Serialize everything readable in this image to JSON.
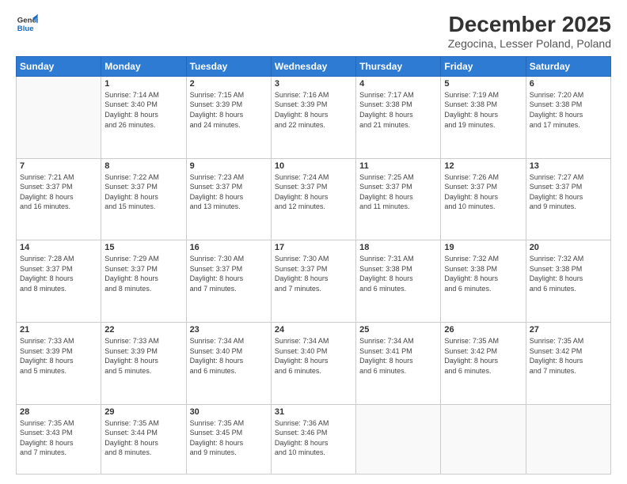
{
  "logo": {
    "line1": "General",
    "line2": "Blue"
  },
  "title": "December 2025",
  "subtitle": "Zegocina, Lesser Poland, Poland",
  "days_of_week": [
    "Sunday",
    "Monday",
    "Tuesday",
    "Wednesday",
    "Thursday",
    "Friday",
    "Saturday"
  ],
  "weeks": [
    [
      {
        "day": "",
        "info": ""
      },
      {
        "day": "1",
        "info": "Sunrise: 7:14 AM\nSunset: 3:40 PM\nDaylight: 8 hours\nand 26 minutes."
      },
      {
        "day": "2",
        "info": "Sunrise: 7:15 AM\nSunset: 3:39 PM\nDaylight: 8 hours\nand 24 minutes."
      },
      {
        "day": "3",
        "info": "Sunrise: 7:16 AM\nSunset: 3:39 PM\nDaylight: 8 hours\nand 22 minutes."
      },
      {
        "day": "4",
        "info": "Sunrise: 7:17 AM\nSunset: 3:38 PM\nDaylight: 8 hours\nand 21 minutes."
      },
      {
        "day": "5",
        "info": "Sunrise: 7:19 AM\nSunset: 3:38 PM\nDaylight: 8 hours\nand 19 minutes."
      },
      {
        "day": "6",
        "info": "Sunrise: 7:20 AM\nSunset: 3:38 PM\nDaylight: 8 hours\nand 17 minutes."
      }
    ],
    [
      {
        "day": "7",
        "info": "Sunrise: 7:21 AM\nSunset: 3:37 PM\nDaylight: 8 hours\nand 16 minutes."
      },
      {
        "day": "8",
        "info": "Sunrise: 7:22 AM\nSunset: 3:37 PM\nDaylight: 8 hours\nand 15 minutes."
      },
      {
        "day": "9",
        "info": "Sunrise: 7:23 AM\nSunset: 3:37 PM\nDaylight: 8 hours\nand 13 minutes."
      },
      {
        "day": "10",
        "info": "Sunrise: 7:24 AM\nSunset: 3:37 PM\nDaylight: 8 hours\nand 12 minutes."
      },
      {
        "day": "11",
        "info": "Sunrise: 7:25 AM\nSunset: 3:37 PM\nDaylight: 8 hours\nand 11 minutes."
      },
      {
        "day": "12",
        "info": "Sunrise: 7:26 AM\nSunset: 3:37 PM\nDaylight: 8 hours\nand 10 minutes."
      },
      {
        "day": "13",
        "info": "Sunrise: 7:27 AM\nSunset: 3:37 PM\nDaylight: 8 hours\nand 9 minutes."
      }
    ],
    [
      {
        "day": "14",
        "info": "Sunrise: 7:28 AM\nSunset: 3:37 PM\nDaylight: 8 hours\nand 8 minutes."
      },
      {
        "day": "15",
        "info": "Sunrise: 7:29 AM\nSunset: 3:37 PM\nDaylight: 8 hours\nand 8 minutes."
      },
      {
        "day": "16",
        "info": "Sunrise: 7:30 AM\nSunset: 3:37 PM\nDaylight: 8 hours\nand 7 minutes."
      },
      {
        "day": "17",
        "info": "Sunrise: 7:30 AM\nSunset: 3:37 PM\nDaylight: 8 hours\nand 7 minutes."
      },
      {
        "day": "18",
        "info": "Sunrise: 7:31 AM\nSunset: 3:38 PM\nDaylight: 8 hours\nand 6 minutes."
      },
      {
        "day": "19",
        "info": "Sunrise: 7:32 AM\nSunset: 3:38 PM\nDaylight: 8 hours\nand 6 minutes."
      },
      {
        "day": "20",
        "info": "Sunrise: 7:32 AM\nSunset: 3:38 PM\nDaylight: 8 hours\nand 6 minutes."
      }
    ],
    [
      {
        "day": "21",
        "info": "Sunrise: 7:33 AM\nSunset: 3:39 PM\nDaylight: 8 hours\nand 5 minutes."
      },
      {
        "day": "22",
        "info": "Sunrise: 7:33 AM\nSunset: 3:39 PM\nDaylight: 8 hours\nand 5 minutes."
      },
      {
        "day": "23",
        "info": "Sunrise: 7:34 AM\nSunset: 3:40 PM\nDaylight: 8 hours\nand 6 minutes."
      },
      {
        "day": "24",
        "info": "Sunrise: 7:34 AM\nSunset: 3:40 PM\nDaylight: 8 hours\nand 6 minutes."
      },
      {
        "day": "25",
        "info": "Sunrise: 7:34 AM\nSunset: 3:41 PM\nDaylight: 8 hours\nand 6 minutes."
      },
      {
        "day": "26",
        "info": "Sunrise: 7:35 AM\nSunset: 3:42 PM\nDaylight: 8 hours\nand 6 minutes."
      },
      {
        "day": "27",
        "info": "Sunrise: 7:35 AM\nSunset: 3:42 PM\nDaylight: 8 hours\nand 7 minutes."
      }
    ],
    [
      {
        "day": "28",
        "info": "Sunrise: 7:35 AM\nSunset: 3:43 PM\nDaylight: 8 hours\nand 7 minutes."
      },
      {
        "day": "29",
        "info": "Sunrise: 7:35 AM\nSunset: 3:44 PM\nDaylight: 8 hours\nand 8 minutes."
      },
      {
        "day": "30",
        "info": "Sunrise: 7:35 AM\nSunset: 3:45 PM\nDaylight: 8 hours\nand 9 minutes."
      },
      {
        "day": "31",
        "info": "Sunrise: 7:36 AM\nSunset: 3:46 PM\nDaylight: 8 hours\nand 10 minutes."
      },
      {
        "day": "",
        "info": ""
      },
      {
        "day": "",
        "info": ""
      },
      {
        "day": "",
        "info": ""
      }
    ]
  ]
}
